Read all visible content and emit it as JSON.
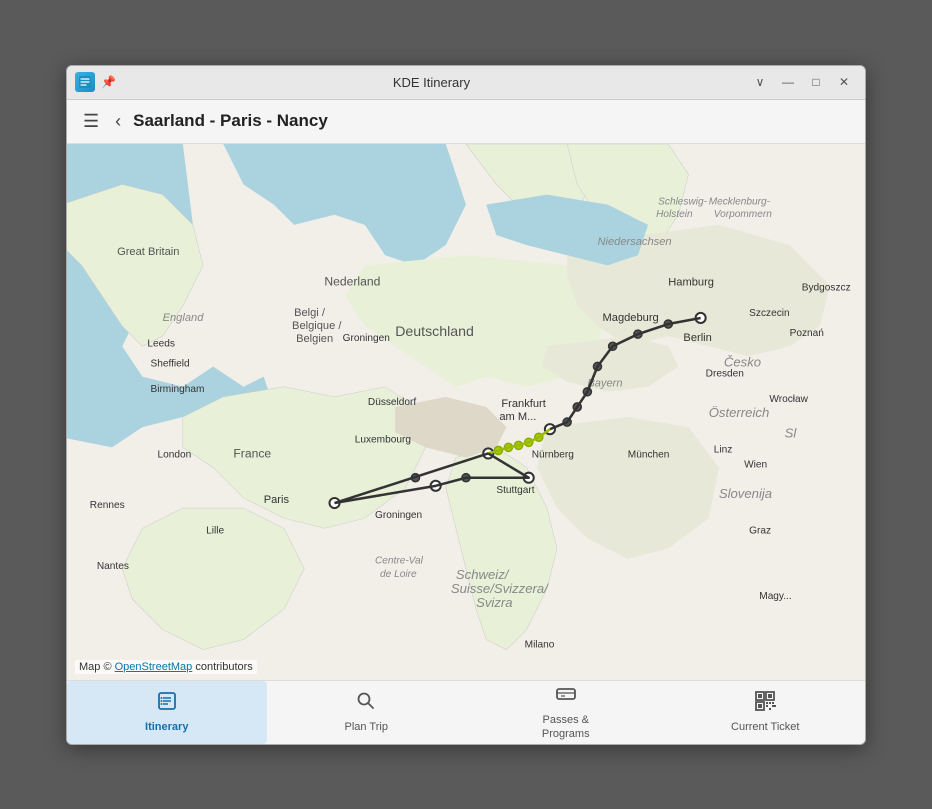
{
  "window": {
    "title": "KDE Itinerary",
    "icon_label": "kde-itinerary-icon",
    "pin_label": "📌"
  },
  "titlebar": {
    "minimize_label": "—",
    "maximize_label": "□",
    "close_label": "✕",
    "chevron_label": "∨"
  },
  "header": {
    "title": "Saarland - Paris - Nancy",
    "hamburger_label": "☰",
    "back_label": "‹"
  },
  "map": {
    "attribution_text": "Map © ",
    "attribution_link_text": "OpenStreetMap",
    "attribution_suffix": " contributors"
  },
  "nav": {
    "items": [
      {
        "id": "itinerary",
        "label": "Itinerary",
        "icon": "itinerary-icon",
        "active": true
      },
      {
        "id": "plan-trip",
        "label": "Plan Trip",
        "icon": "search-icon",
        "active": false
      },
      {
        "id": "passes-programs",
        "label": "Passes &\nPrograms",
        "icon": "passes-icon",
        "active": false
      },
      {
        "id": "current-ticket",
        "label": "Current Ticket",
        "icon": "qr-icon",
        "active": false
      }
    ]
  }
}
